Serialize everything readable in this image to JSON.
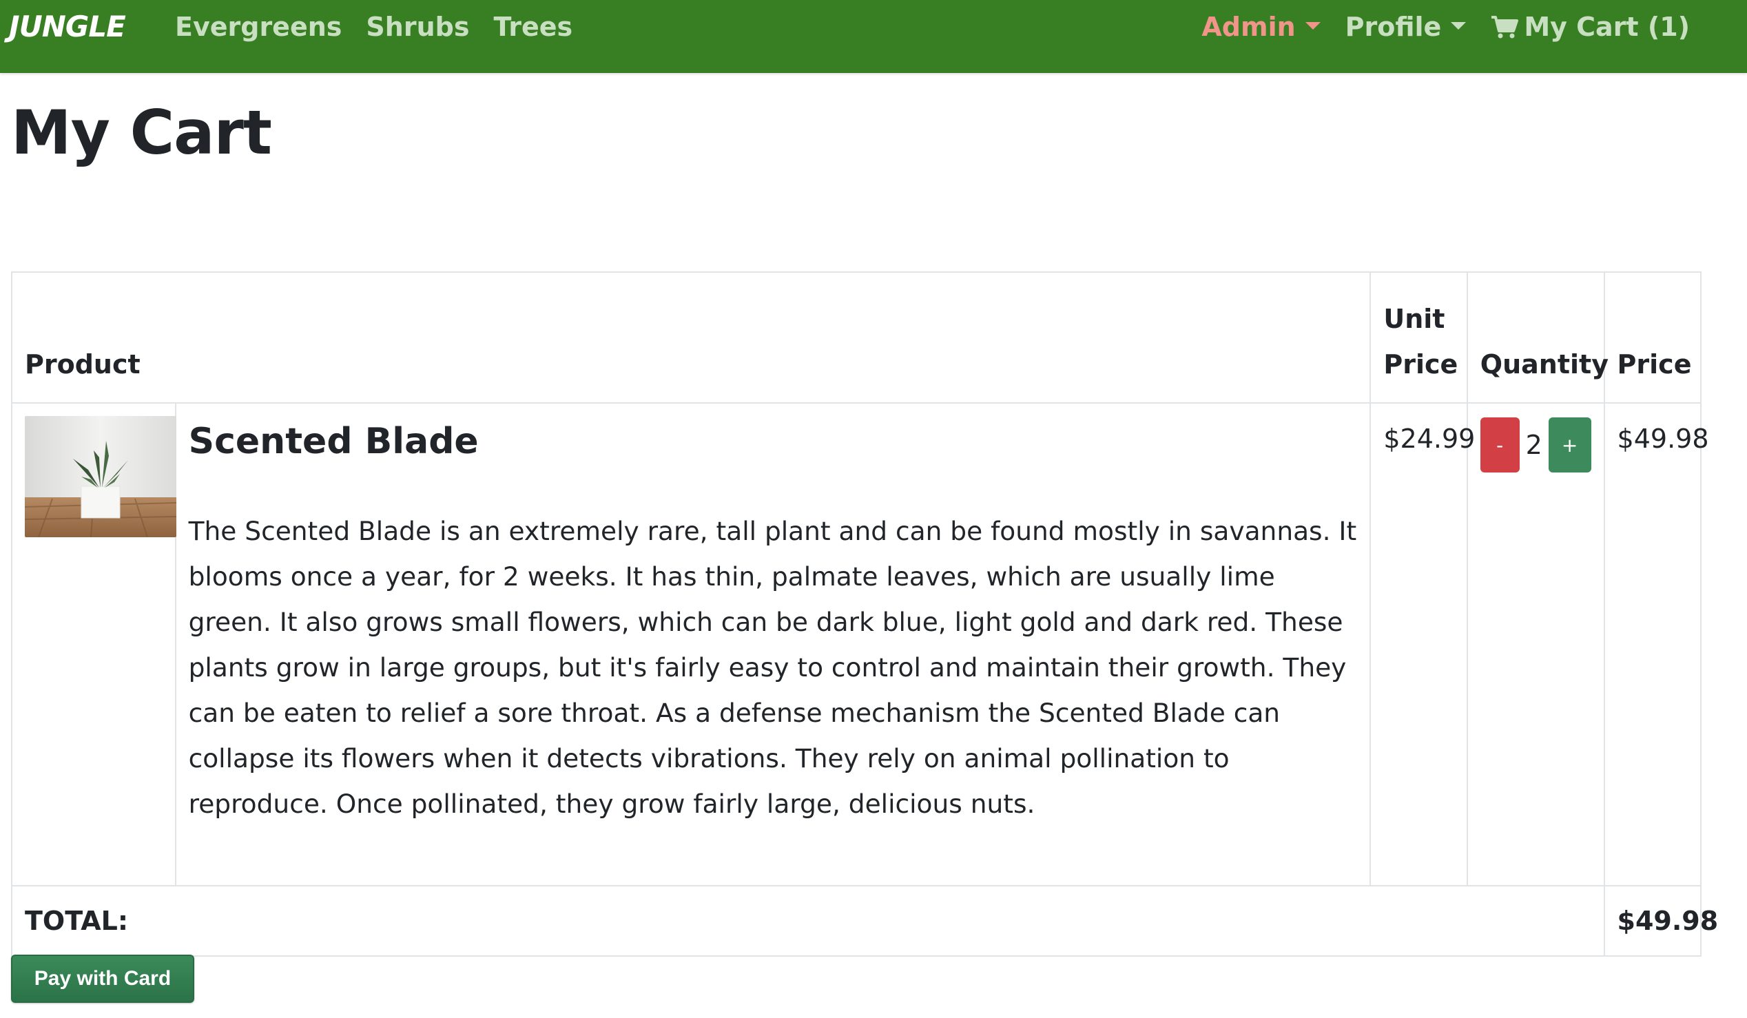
{
  "navbar": {
    "brand": "JUNGLE",
    "links": [
      {
        "label": "Evergreens"
      },
      {
        "label": "Shrubs"
      },
      {
        "label": "Trees"
      }
    ],
    "admin_label": "Admin",
    "profile_label": "Profile",
    "cart_label": "My Cart (1)",
    "bg_color": "#387f24",
    "admin_color": "#f1948a"
  },
  "page": {
    "title": "My Cart"
  },
  "table": {
    "headers": {
      "product": "Product",
      "unit_price": "Unit Price",
      "quantity": "Quantity",
      "price": "Price"
    },
    "rows": [
      {
        "name": "Scented Blade",
        "description": "The Scented Blade is an extremely rare, tall plant and can be found mostly in savannas. It blooms once a year, for 2 weeks. It has thin, palmate leaves, which are usually lime green. It also grows small flowers, which can be dark blue, light gold and dark red. These plants grow in large groups, but it's fairly easy to control and maintain their growth. They can be eaten to relief a sore throat. As a defense mechanism the Scented Blade can collapse its flowers when it detects vibrations. They rely on animal pollination to reproduce. Once pollinated, they grow fairly large, delicious nuts.",
        "unit_price": "$24.99",
        "quantity": "2",
        "price": "$49.98",
        "minus_label": "-",
        "plus_label": "+"
      }
    ],
    "total_label": "TOTAL:",
    "total_value": "$49.98"
  },
  "pay_button": {
    "label": "Pay with Card"
  },
  "icons": {
    "cart": "shopping-cart-icon",
    "caret": "caret-down-icon"
  }
}
